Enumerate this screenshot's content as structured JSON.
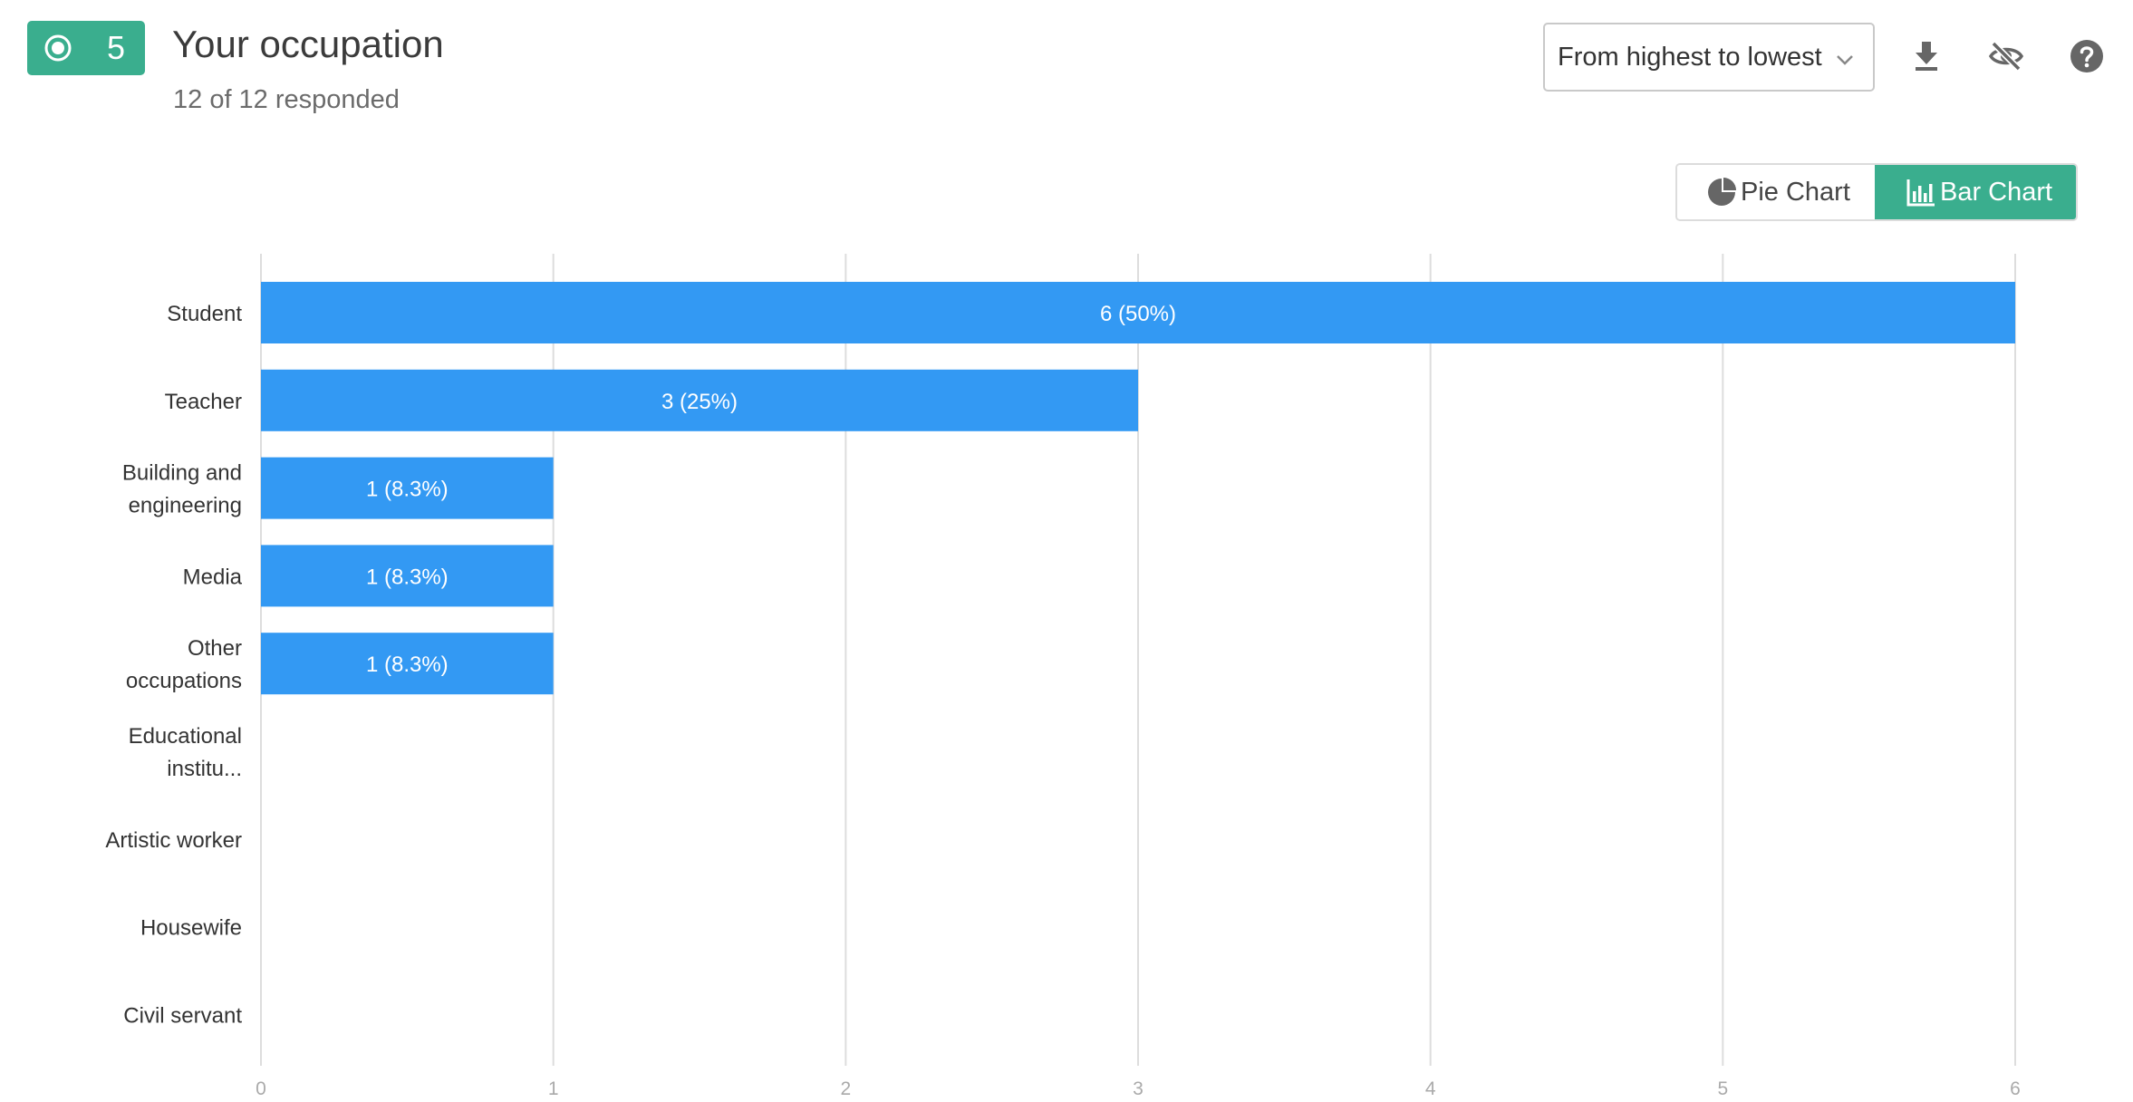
{
  "question": {
    "number": "5",
    "title": "Your occupation",
    "responded": "12 of 12 responded"
  },
  "toolbar": {
    "sort_selected": "From highest to lowest",
    "icons": [
      "download-icon",
      "hide-eye-icon",
      "help-icon"
    ]
  },
  "chart_toggle": {
    "pie_label": "Pie Chart",
    "bar_label": "Bar Chart",
    "active": "bar"
  },
  "colors": {
    "accent": "#3aae8e",
    "bar": "#3399f3",
    "grid": "#dddddd"
  },
  "chart_data": {
    "type": "bar",
    "orientation": "horizontal",
    "categories": [
      "Student",
      "Teacher",
      "Building and engineering",
      "Media",
      "Other occupations",
      "Educational institu...",
      "Artistic worker",
      "Housewife",
      "Civil servant"
    ],
    "category_lines": [
      [
        "Student"
      ],
      [
        "Teacher"
      ],
      [
        "Building and",
        "engineering"
      ],
      [
        "Media"
      ],
      [
        "Other",
        "occupations"
      ],
      [
        "Educational",
        "institu..."
      ],
      [
        "Artistic worker"
      ],
      [
        "Housewife"
      ],
      [
        "Civil servant"
      ]
    ],
    "values": [
      6,
      3,
      1,
      1,
      1,
      0,
      0,
      0,
      0
    ],
    "data_labels": [
      "6 (50%)",
      "3 (25%)",
      "1 (8.3%)",
      "1 (8.3%)",
      "1 (8.3%)",
      "",
      "",
      "",
      ""
    ],
    "xlim": [
      0,
      6
    ],
    "x_ticks": [
      "0",
      "1",
      "2",
      "3",
      "4",
      "5",
      "6"
    ],
    "grid": true
  }
}
